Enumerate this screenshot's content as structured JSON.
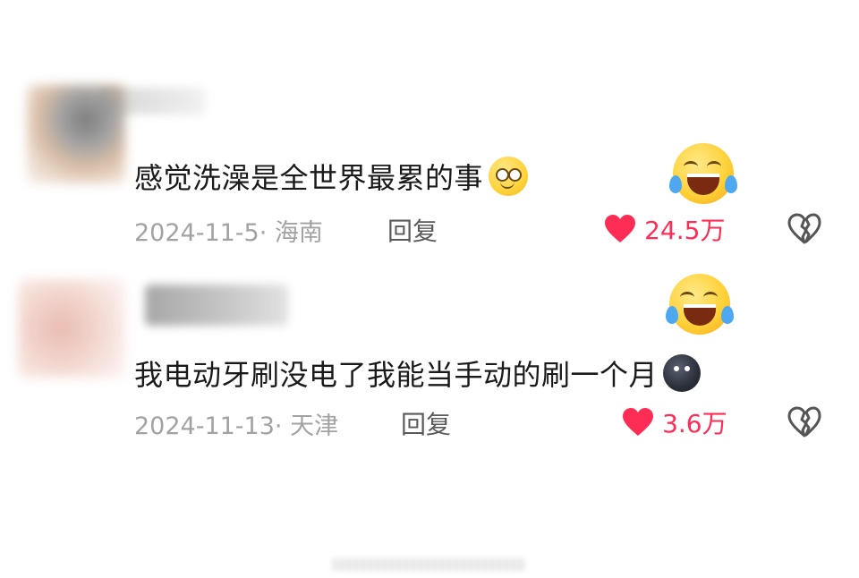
{
  "comments": [
    {
      "text": "感觉洗澡是全世界最累的事",
      "date_location": "2024-11-5· 海南",
      "reply_label": "回复",
      "like_count": "24.5万",
      "inline_emoji": "smiling-face-emoji",
      "reaction_emoji": "laughing-tears-emoji"
    },
    {
      "text": "我电动牙刷没电了我能当手动的刷一个月",
      "date_location": "2024-11-13· 天津",
      "reply_label": "回复",
      "like_count": "3.6万",
      "inline_emoji": "dark-face-emoji",
      "reaction_emoji": "laughing-tears-emoji"
    }
  ],
  "icons": {
    "like": "heart-icon",
    "dislike": "broken-heart-icon"
  },
  "colors": {
    "like_accent": "#ff2c55",
    "meta_text": "#a2a2a2",
    "comment_text": "#1a1a1a"
  }
}
